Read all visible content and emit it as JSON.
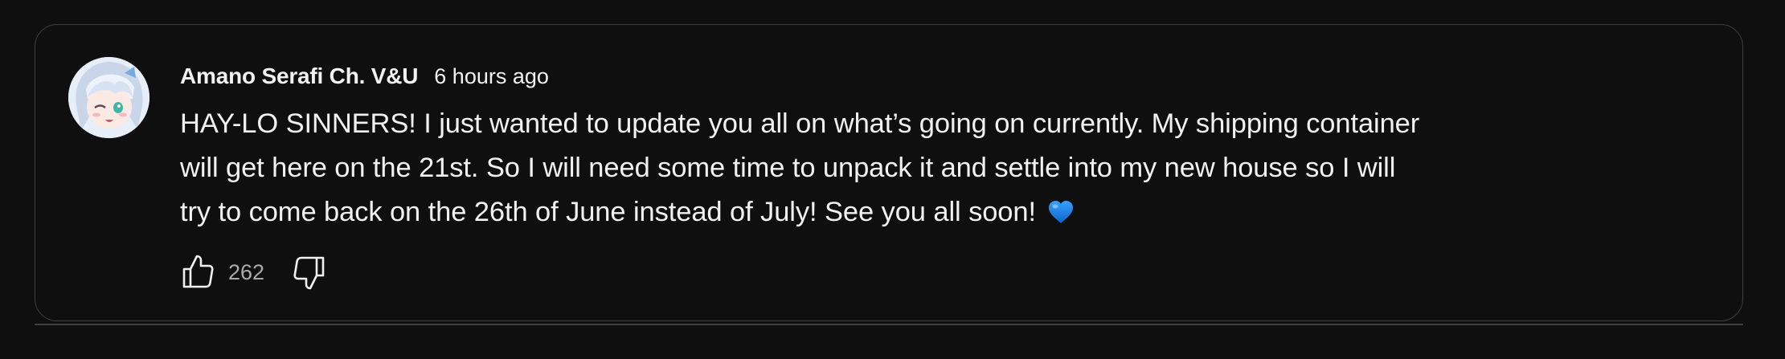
{
  "post": {
    "author": "Amano Serafi Ch. V&U",
    "timestamp": "6 hours ago",
    "text_lines": [
      "HAY-LO SINNERS! I just wanted to update you all on what’s going on currently. My shipping container",
      "will get here on the 21st. So I will need some time to unpack it and settle into my new house so I will",
      "try to come back on the 26th of June instead of July! See you all soon!"
    ],
    "emoji_icon": "blue-heart-icon",
    "like_count": "262",
    "like_icon": "thumbs-up-icon",
    "dislike_icon": "thumbs-down-icon"
  },
  "colors": {
    "background": "#0f0f0f",
    "border": "#3f3f3f",
    "text": "#f1f1f1",
    "secondary_text": "#aaaaaa",
    "heart": "#1e90ff"
  }
}
